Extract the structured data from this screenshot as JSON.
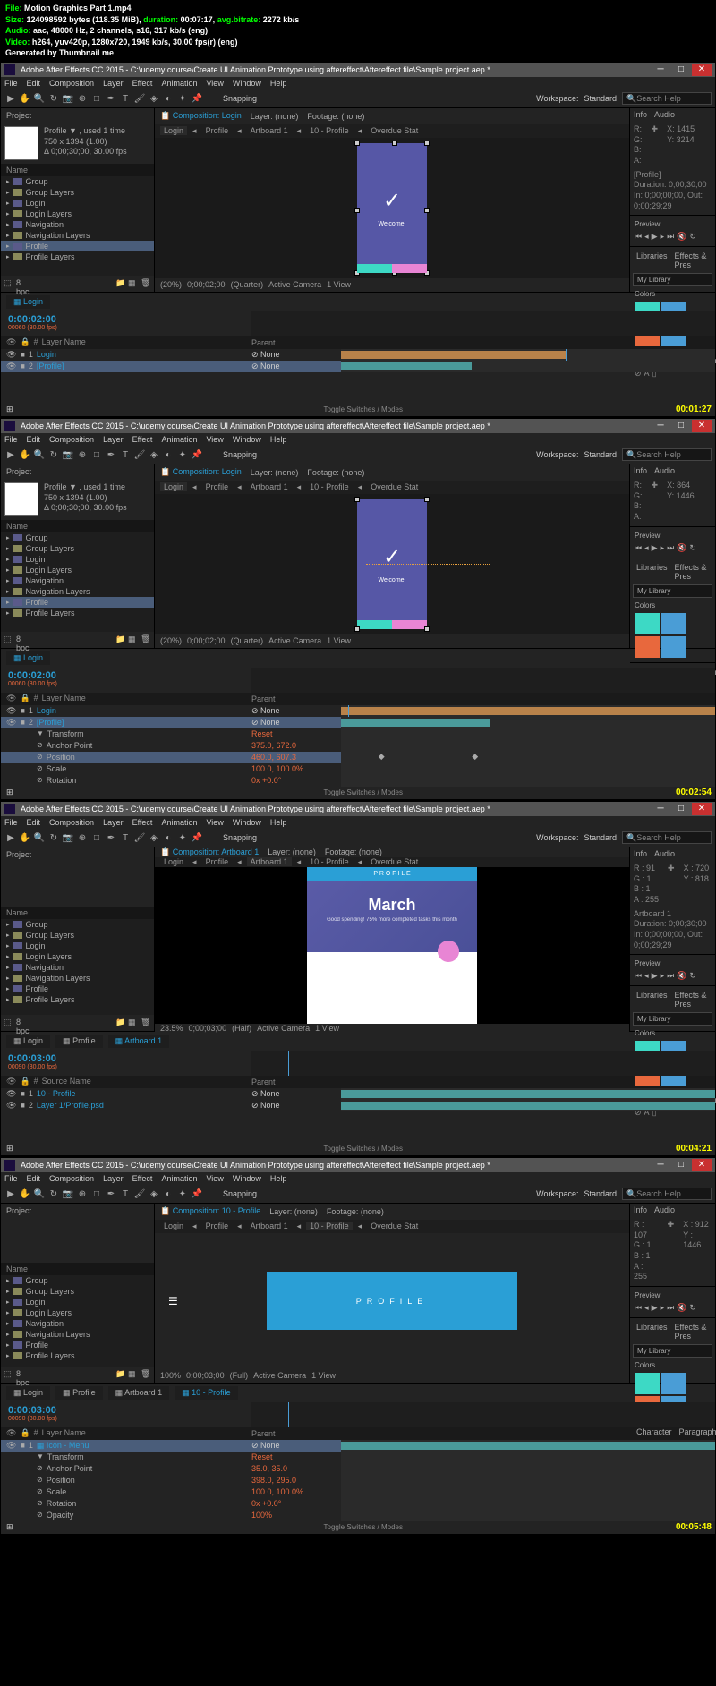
{
  "header": {
    "file_label": "File:",
    "file_name": "Motion Graphics Part 1.mp4",
    "size_label": "Size:",
    "size_bytes": "124098592 bytes (118.35 MiB),",
    "duration_label": "duration:",
    "duration": "00:07:17,",
    "bitrate_label": "avg.bitrate:",
    "bitrate": "2272 kb/s",
    "audio_label": "Audio:",
    "audio": "aac, 48000 Hz, 2 channels, s16, 317 kb/s (eng)",
    "video_label": "Video:",
    "video": "h264, yuv420p, 1280x720, 1949 kb/s, 30.00 fps(r) (eng)",
    "generated": "Generated by Thumbnail me"
  },
  "window_title": "Adobe After Effects CC 2015 - C:\\udemy course\\Create UI Animation Prototype using aftereffect\\Aftereffect file\\Sample project.aep *",
  "menu": [
    "File",
    "Edit",
    "Composition",
    "Layer",
    "Effect",
    "Animation",
    "View",
    "Window",
    "Help"
  ],
  "workspace": {
    "label": "Workspace:",
    "value": "Standard",
    "search": "Search Help",
    "snapping": "Snapping"
  },
  "project": {
    "tab": "Project",
    "name": "Profile ▼ , used 1 time",
    "dims": "750 x 1394 (1.00)",
    "dur": "Δ 0;00;30;00, 30.00 fps",
    "name_col": "Name",
    "tree": [
      "Group",
      "Group Layers",
      "Login",
      "Login Layers",
      "Navigation",
      "Navigation Layers",
      "Profile",
      "Profile Layers"
    ],
    "bpc": "8 bpc"
  },
  "comp": {
    "comp_label": "Composition:",
    "tabs": [
      "Login",
      "Profile",
      "Artboard 1",
      "10 - Profile",
      "Overdue Stat"
    ],
    "layer_none": "Layer: (none)",
    "footage_none": "Footage: (none)"
  },
  "viewer_footer": {
    "zoom": "(20%)",
    "time": "0;00;02;00",
    "quality": "(Quarter)",
    "camera": "Active Camera",
    "view": "1 View"
  },
  "info": {
    "tab1": "Info",
    "tab2": "Audio",
    "r": "R:",
    "g": "G:",
    "b": "B:",
    "a": "A:",
    "x": "X: 1415",
    "y": "Y: 3214",
    "profile": "[Profile]",
    "duration": "Duration: 0;00;30;00",
    "inout": "In: 0;00;00;00, Out: 0;00;29;29"
  },
  "preview": {
    "label": "Preview"
  },
  "libraries": {
    "tab1": "Libraries",
    "tab2": "Effects & Pres",
    "dropdown": "My Library",
    "colors": "Colors"
  },
  "character": {
    "tab1": "Character",
    "tab2": "Paragraph"
  },
  "timeline1": {
    "tab": "Login",
    "tc": "0:00:02:00",
    "fps": "00060 (30.00 fps)",
    "cols": {
      "num": "#",
      "source": "Layer Name",
      "parent": "Parent",
      "none": "None"
    },
    "layers": [
      {
        "n": "1",
        "name": "Login"
      },
      {
        "n": "2",
        "name": "[Profile]"
      }
    ],
    "toggle": "Toggle Switches / Modes"
  },
  "timeline2": {
    "transform": "Transform",
    "props": [
      "Anchor Point",
      "Position",
      "Scale",
      "Rotation"
    ],
    "vals": [
      "Reset",
      "375.0, 672.0",
      "460.0, 607.3",
      "100.0, 100.0%",
      "0x +0.0°"
    ]
  },
  "frame3": {
    "comp": "Artboard 1",
    "tc": "0:00:03:00",
    "march": "March",
    "march_sub": "Good spending! 75% more completed tasks this month",
    "profile_bar": "P R O F I L E",
    "zoom": "23.5%",
    "quality": "(Half)",
    "layers": [
      {
        "n": "1",
        "name": "10 - Profile"
      },
      {
        "n": "2",
        "name": "Layer 1/Profile.psd"
      }
    ],
    "info": {
      "r": "R : 91",
      "g": "G : 1",
      "b": "B : 1",
      "a": "A : 255",
      "x": "X : 720",
      "y": "Y : 818",
      "art": "Artboard 1",
      "dur": "Duration: 0;00;30;00",
      "inout": "In: 0;00;00;00, Out: 0;00;29;29"
    }
  },
  "frame4": {
    "comp": "10 - Profile",
    "tc": "0:00:03:00",
    "fps": "00090 (30.00 fps)",
    "zoom": "100%",
    "profile_text": "PROFILE",
    "layer": "Icon - Menu",
    "transform": "Transform",
    "props": [
      "Anchor Point",
      "Position",
      "Scale",
      "Rotation",
      "Opacity"
    ],
    "vals": [
      "Reset",
      "35.0, 35.0",
      "398.0, 295.0",
      "100.0, 100.0%",
      "0x +0.0°",
      "100%"
    ],
    "info": {
      "r": "R : 107",
      "g": "G : 1",
      "b": "B : 1",
      "a": "A : 255",
      "x": "X : 912",
      "y": "Y : 1446"
    }
  },
  "timestamps": [
    "00:01:27",
    "00:02:54",
    "00:04:21",
    "00:05:48"
  ]
}
